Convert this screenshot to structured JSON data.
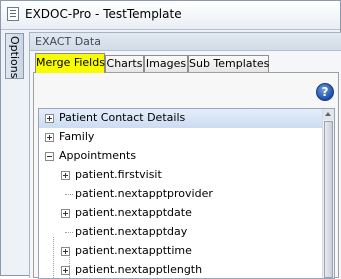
{
  "window": {
    "title": "EXDOC-Pro - TestTemplate"
  },
  "sidebar": {
    "options_label": "Options"
  },
  "panel": {
    "header": "EXACT Data"
  },
  "tabs": [
    {
      "label": "Merge Fields",
      "active": true
    },
    {
      "label": "Charts",
      "active": false
    },
    {
      "label": "Images",
      "active": false
    },
    {
      "label": "Sub Templates",
      "active": false
    }
  ],
  "help": {
    "glyph": "?"
  },
  "tree": {
    "items": [
      {
        "label": "Patient Contact Details",
        "expander": "plus",
        "selected": true
      },
      {
        "label": "Family",
        "expander": "plus",
        "selected": false
      },
      {
        "label": "Appointments",
        "expander": "minus",
        "selected": false
      },
      {
        "label": "patient.firstvisit",
        "expander": "plus",
        "selected": false
      },
      {
        "label": "patient.nextapptprovider",
        "expander": "none",
        "selected": false
      },
      {
        "label": "patient.nextapptdate",
        "expander": "plus",
        "selected": false
      },
      {
        "label": "patient.nextapptday",
        "expander": "none",
        "selected": false
      },
      {
        "label": "patient.nextappttime",
        "expander": "plus",
        "selected": false
      },
      {
        "label": "patient.nextapptlength",
        "expander": "plus",
        "selected": false
      }
    ]
  },
  "colors": {
    "active_tab": "#fafd00",
    "selected_row": "#cddcf2",
    "help_button": "#1d4fa8"
  }
}
